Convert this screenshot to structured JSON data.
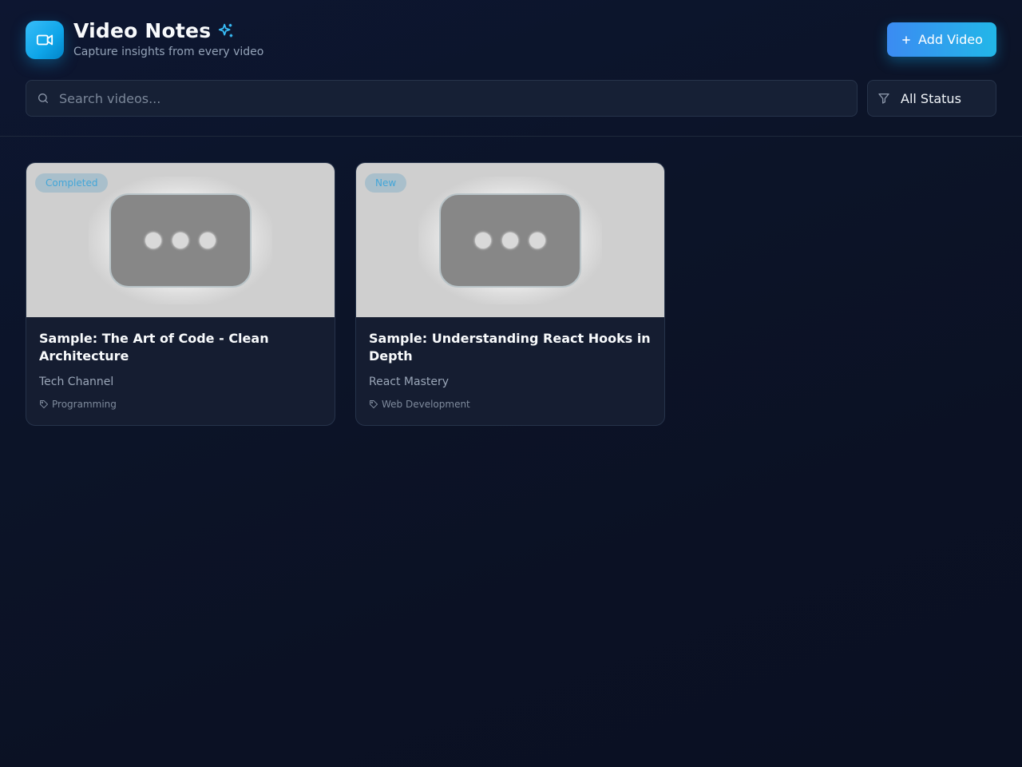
{
  "header": {
    "title": "Video Notes",
    "subtitle": "Capture insights from every video",
    "add_button_label": "Add Video"
  },
  "search": {
    "placeholder": "Search videos...",
    "value": ""
  },
  "filter": {
    "selected": "All Status"
  },
  "videos": [
    {
      "status": "Completed",
      "title": "Sample: The Art of Code - Clean Architecture",
      "channel": "Tech Channel",
      "tag": "Programming"
    },
    {
      "status": "New",
      "title": "Sample: Understanding React Hooks in Depth",
      "channel": "React Mastery",
      "tag": "Web Development"
    }
  ],
  "colors": {
    "accent": "#0ea5e9",
    "background": "#0c1326",
    "card": "#151d31"
  }
}
